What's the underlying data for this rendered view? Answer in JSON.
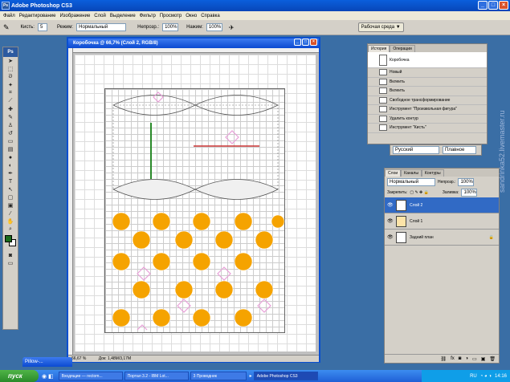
{
  "app": {
    "title": "Adobe Photoshop CS3",
    "menu": [
      "Файл",
      "Редактирование",
      "Изображение",
      "Слой",
      "Выделение",
      "Фильтр",
      "Просмотр",
      "Окно",
      "Справка"
    ]
  },
  "options": {
    "brush_label": "Кисть:",
    "brush_size": "5",
    "mode_label": "Режим:",
    "mode_value": "Нормальный",
    "opacity_label": "Непрозр.:",
    "opacity_value": "100%",
    "flow_label": "Нажим:",
    "flow_value": "100%",
    "workspace_label": "Рабочая среда ▼"
  },
  "document": {
    "title": "Коробочка @ 66,7% (Слой 2, RGB/8)",
    "zoom": "66,67 %",
    "doc_size": "Док: 1,48М/3,17М"
  },
  "history": {
    "tabs": [
      "История",
      "Операции"
    ],
    "snapshot": "Коробочка",
    "items": [
      "Новый",
      "Вклеить",
      "Вклеить",
      "Свободное трансформирование",
      "Инструмент \"Произвольная фигура\"",
      "Удалить контур",
      "Инструмент \"Кисть\""
    ]
  },
  "charpanel": {
    "font": "Русский",
    "style": "Плавное"
  },
  "layers": {
    "tabs": [
      "Слои",
      "Каналы",
      "Контуры"
    ],
    "blend_mode": "Нормальный",
    "opacity_label": "Непрозр.:",
    "opacity_value": "100%",
    "lock_label": "Закрепить:",
    "fill_label": "Заливка:",
    "fill_value": "100%",
    "items": [
      {
        "name": "Слой 2",
        "selected": true
      },
      {
        "name": "Слой 1",
        "selected": false
      },
      {
        "name": "Задний план",
        "selected": false
      }
    ]
  },
  "minimized": "Pillow-...",
  "taskbar": {
    "start": "пуск",
    "tasks": [
      "Входящие — rectom...",
      "Портал 3.2 - IBM Lot...",
      "3 Проводник",
      "Adobe Photoshop CS3"
    ],
    "lang": "RU",
    "time": "14:16"
  },
  "watermark": "sandrinka52.livemaster.ru",
  "colors": {
    "foreground": "#1a6b1a",
    "background": "#ffffff",
    "orange": "#f5a300",
    "pink": "#e8a0d8"
  }
}
